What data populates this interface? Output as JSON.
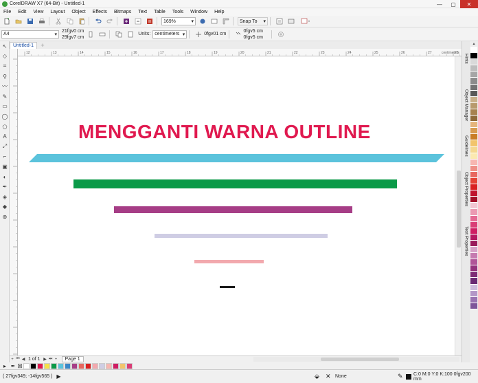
{
  "window": {
    "title": "CorelDRAW X7 (64-Bit) - Untitled-1",
    "minimize": "—",
    "maximize": "▢",
    "close": "✕"
  },
  "menu": [
    "File",
    "Edit",
    "View",
    "Layout",
    "Object",
    "Effects",
    "Bitmaps",
    "Text",
    "Table",
    "Tools",
    "Window",
    "Help"
  ],
  "toolbar1": {
    "zoom": "169%",
    "snap_to": "Snap To"
  },
  "toolbar2": {
    "page_size": "A4",
    "width": "21fgv0 cm",
    "height": "29fgv7 cm",
    "units_label": "Units:",
    "units_value": "centimeters",
    "nudge": "0fgv01 cm",
    "dup_x": "0fgv5 cm",
    "dup_y": "0fgv5 cm"
  },
  "document_tab": "Untitled-1",
  "ruler_unit": "centimeters",
  "hruler_ticks": [
    "12",
    "13",
    "14",
    "15",
    "16",
    "17",
    "18",
    "19",
    "20",
    "21",
    "22",
    "23",
    "24",
    "25",
    "26",
    "27",
    "28"
  ],
  "canvas": {
    "headline": "MENGGANTI WARNA OUTLINE",
    "headline_color": "#e0194f",
    "shapes": [
      {
        "name": "cyan-parallelogram",
        "color": "#5bc3dc"
      },
      {
        "name": "green-bar",
        "color": "#0a9a48"
      },
      {
        "name": "purple-bar",
        "color": "#a63d86"
      },
      {
        "name": "lavender-bar",
        "color": "#cfcde4"
      },
      {
        "name": "pink-bar",
        "color": "#f2a9ae"
      },
      {
        "name": "black-dash",
        "color": "#1a1a1a"
      }
    ]
  },
  "dockers": [
    "Hints",
    "Object Manager",
    "Guidelines",
    "Object Properties",
    "Text Properties"
  ],
  "palette": [
    "#ffffff",
    "#000000",
    "#d9d9d9",
    "#bdbdbd",
    "#a6a6a6",
    "#8c8c8c",
    "#737373",
    "#595959",
    "#c9b08a",
    "#b89a6d",
    "#a7824f",
    "#8f6a39",
    "#e5b57b",
    "#d89b4f",
    "#c97d25",
    "#f2c46b",
    "#f5d890",
    "#fbe9b0",
    "#f7b6b0",
    "#ef8f86",
    "#e8675f",
    "#e44234",
    "#d92020",
    "#c0132e",
    "#a30f28",
    "#f2c6d2",
    "#eb9ab2",
    "#e46a93",
    "#d93d76",
    "#cf1e63",
    "#b41961",
    "#9a1b5c",
    "#d6a2c7",
    "#c57ab0",
    "#b05598",
    "#93337d",
    "#7e2c76",
    "#6a2a73",
    "#cdbcdc",
    "#b497c7",
    "#9a73b1",
    "#7f559a"
  ],
  "page_nav": {
    "first": "⏮",
    "prev": "◀",
    "position": "1 of 1",
    "next": "▶",
    "last": "⏭",
    "add": "+",
    "page_tab": "Page 1"
  },
  "doc_palette": [
    "#ffffff",
    "#000000",
    "#e0194f",
    "#f5e04a",
    "#0a9a48",
    "#5bc3dc",
    "#3a87c8",
    "#a63d86",
    "#e8675f",
    "#d92020",
    "#f2a9ae",
    "#cfcde4",
    "#f7b6b0",
    "#cf1e63",
    "#f2c46b",
    "#d93d76"
  ],
  "status": {
    "coordinates": "( 27fgv349; -14fgv565 )",
    "fill": "None",
    "outline": "C:0 M:0 Y:0 K:100  0fgv200 mm"
  }
}
